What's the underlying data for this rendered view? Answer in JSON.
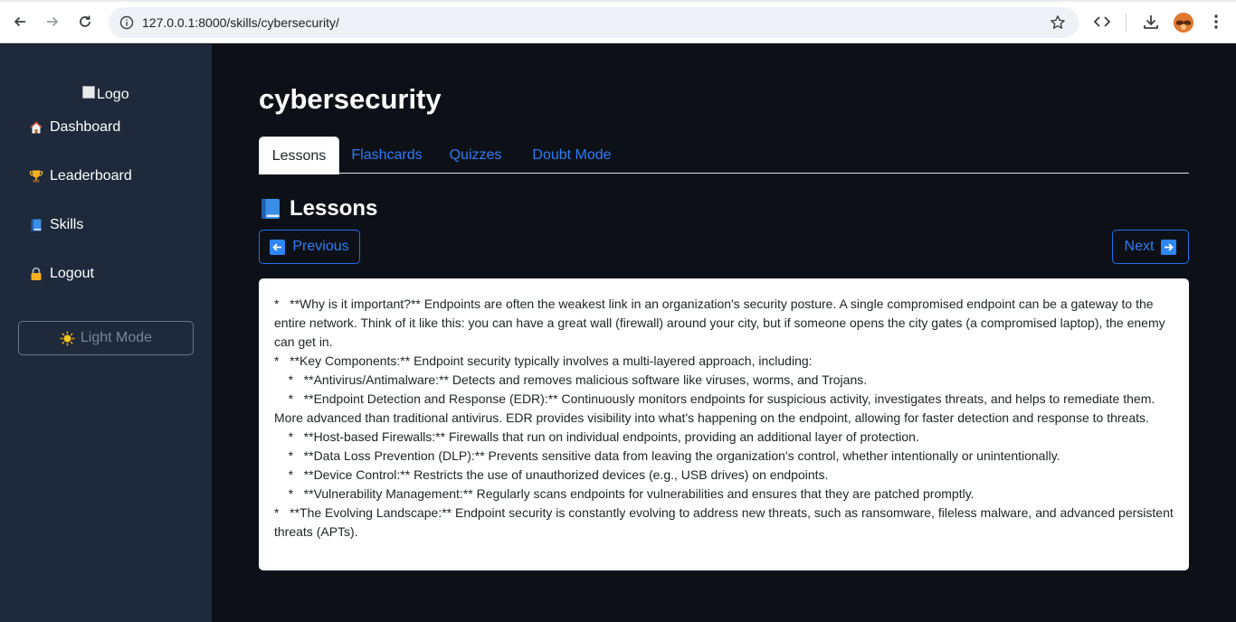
{
  "browser": {
    "url": "127.0.0.1:8000/skills/cybersecurity/"
  },
  "sidebar": {
    "logo_alt": "Logo",
    "items": [
      {
        "label": "Dashboard",
        "icon": "house-icon"
      },
      {
        "label": "Leaderboard",
        "icon": "trophy-icon"
      },
      {
        "label": "Skills",
        "icon": "book-icon"
      },
      {
        "label": "Logout",
        "icon": "lock-icon"
      }
    ],
    "mode_button": "Light Mode"
  },
  "main": {
    "title": "cybersecurity",
    "tabs": [
      {
        "label": "Lessons",
        "active": true
      },
      {
        "label": "Flashcards",
        "active": false
      },
      {
        "label": "Quizzes",
        "active": false
      },
      {
        "label": "Doubt Mode",
        "active": false
      }
    ],
    "section_title": "Lessons",
    "prev_label": "Previous",
    "next_label": "Next",
    "lesson_lines": [
      "*   **Why is it important?** Endpoints are often the weakest link in an organization's security posture. A single compromised endpoint can be a gateway to the entire network. Think of it like this: you can have a great wall (firewall) around your city, but if someone opens the city gates (a compromised laptop), the enemy can get in.",
      "*   **Key Components:** Endpoint security typically involves a multi-layered approach, including:",
      "    *   **Antivirus/Antimalware:** Detects and removes malicious software like viruses, worms, and Trojans.",
      "    *   **Endpoint Detection and Response (EDR):** Continuously monitors endpoints for suspicious activity, investigates threats, and helps to remediate them. More advanced than traditional antivirus. EDR provides visibility into what's happening on the endpoint, allowing for faster detection and response to threats.",
      "    *   **Host-based Firewalls:** Firewalls that run on individual endpoints, providing an additional layer of protection.",
      "    *   **Data Loss Prevention (DLP):** Prevents sensitive data from leaving the organization's control, whether intentionally or unintentionally.",
      "    *   **Device Control:** Restricts the use of unauthorized devices (e.g., USB drives) on endpoints.",
      "    *   **Vulnerability Management:** Regularly scans endpoints for vulnerabilities and ensures that they are patched promptly.",
      "*   **The Evolving Landscape:** Endpoint security is constantly evolving to address new threats, such as ransomware, fileless malware, and advanced persistent threats (APTs)."
    ]
  },
  "colors": {
    "sidebar_bg": "#1e293b",
    "main_bg": "#0d1117",
    "accent": "#2f7cf6"
  }
}
